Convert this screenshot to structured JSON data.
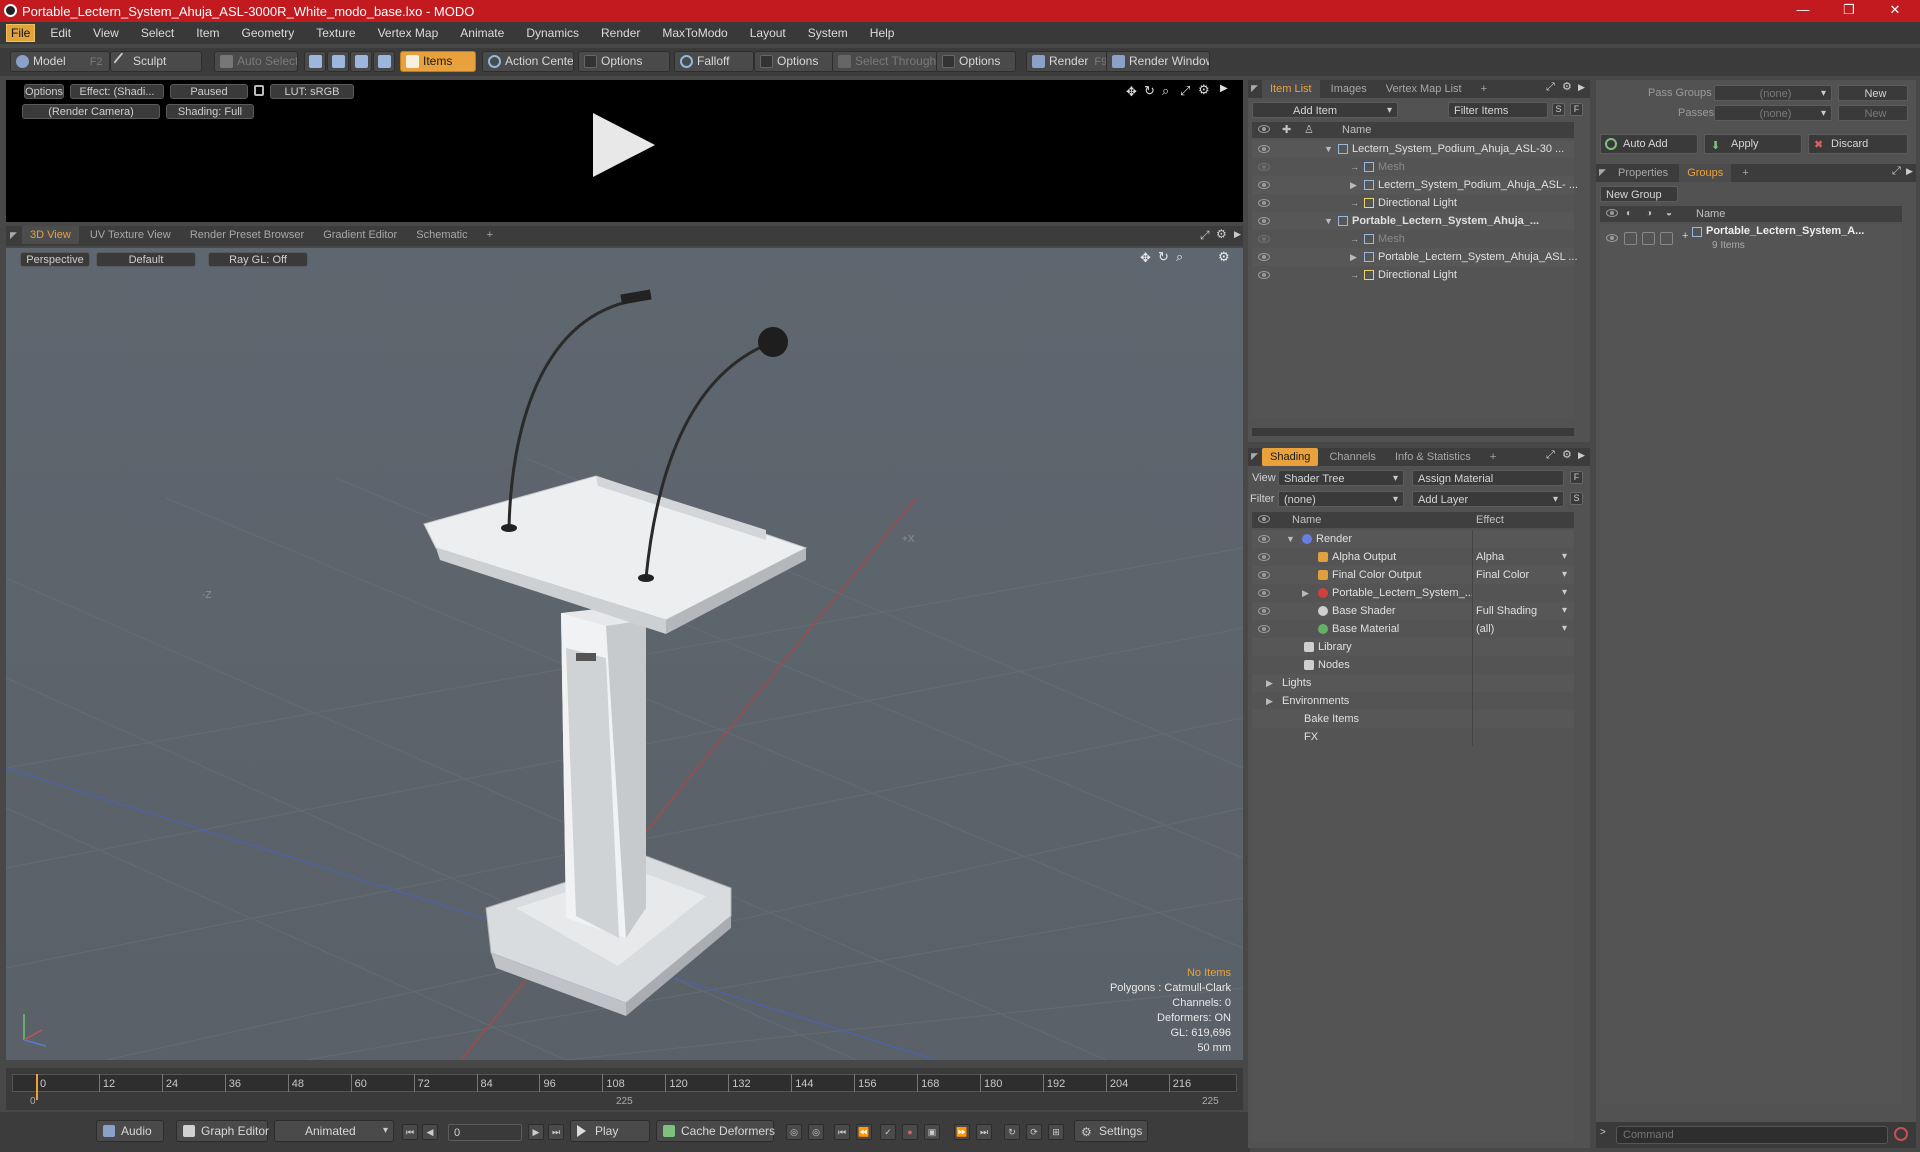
{
  "window": {
    "title": "Portable_Lectern_System_Ahuja_ASL-3000R_White_modo_base.lxo - MODO",
    "min": "—",
    "max": "❐",
    "close": "✕"
  },
  "menu": [
    "File",
    "Edit",
    "View",
    "Select",
    "Item",
    "Geometry",
    "Texture",
    "Vertex Map",
    "Animate",
    "Dynamics",
    "Render",
    "MaxToModo",
    "Layout",
    "System",
    "Help"
  ],
  "toolbar": {
    "model": "Model",
    "model_key": "F2",
    "sculpt": "Sculpt",
    "auto_select": "Auto Select",
    "items": "Items",
    "action_center": "Action Center",
    "options1": "Options",
    "falloff": "Falloff",
    "options2": "Options",
    "select_through": "Select Through",
    "options3": "Options",
    "render": "Render",
    "render_key": "F9",
    "render_window": "Render Window"
  },
  "preview": {
    "options": "Options",
    "effect": "Effect: (Shadi...",
    "paused": "Paused",
    "lut": "LUT: sRGB",
    "camera": "(Render Camera)",
    "shading": "Shading: Full"
  },
  "view_tabs": [
    "3D View",
    "UV Texture View",
    "Render Preset Browser",
    "Gradient Editor",
    "Schematic"
  ],
  "viewport": {
    "projection": "Perspective",
    "style": "Default",
    "raygl": "Ray GL: Off",
    "info": [
      "No Items",
      "Polygons : Catmull-Clark",
      "Channels: 0",
      "Deformers: ON",
      "GL: 619,696",
      "50 mm"
    ],
    "axis_x": "+X",
    "axis_z": "-Z"
  },
  "timeline": {
    "ticks": [
      "0",
      "12",
      "24",
      "36",
      "48",
      "60",
      "72",
      "84",
      "96",
      "108",
      "120",
      "132",
      "144",
      "156",
      "168",
      "180",
      "192",
      "204",
      "216"
    ],
    "start": "0",
    "mid": "225",
    "end": "225"
  },
  "bottom": {
    "audio": "Audio",
    "graph_editor": "Graph Editor",
    "animated": "Animated",
    "frame": "0",
    "play": "Play",
    "cache": "Cache Deformers",
    "settings": "Settings"
  },
  "item_list": {
    "tabs": [
      "Item List",
      "Images",
      "Vertex Map List"
    ],
    "add_item": "Add Item",
    "filter": "Filter Items",
    "s": "S",
    "f": "F",
    "col_name": "Name",
    "rows": [
      {
        "label": "Lectern_System_Podium_Ahuja_ASL-30 ...",
        "indent": 0,
        "bold": false,
        "dim": false
      },
      {
        "label": "Mesh",
        "indent": 1,
        "bold": false,
        "dim": true
      },
      {
        "label": "Lectern_System_Podium_Ahuja_ASL- ...",
        "indent": 1,
        "bold": false,
        "dim": false
      },
      {
        "label": "Directional Light",
        "indent": 1,
        "bold": false,
        "dim": false
      },
      {
        "label": "Portable_Lectern_System_Ahuja_...",
        "indent": 0,
        "bold": true,
        "dim": false
      },
      {
        "label": "Mesh",
        "indent": 1,
        "bold": false,
        "dim": true
      },
      {
        "label": "Portable_Lectern_System_Ahuja_ASL ...",
        "indent": 1,
        "bold": false,
        "dim": false
      },
      {
        "label": "Directional Light",
        "indent": 1,
        "bold": false,
        "dim": false
      }
    ]
  },
  "shading": {
    "tabs": [
      "Shading",
      "Channels",
      "Info & Statistics"
    ],
    "view_label": "View",
    "view_value": "Shader Tree",
    "assign": "Assign Material",
    "filter_label": "Filter",
    "filter_value": "(none)",
    "add_layer": "Add Layer",
    "col_name": "Name",
    "col_effect": "Effect",
    "rows": [
      {
        "name": "Render",
        "effect": ""
      },
      {
        "name": "Alpha Output",
        "effect": "Alpha"
      },
      {
        "name": "Final Color Output",
        "effect": "Final Color"
      },
      {
        "name": "Portable_Lectern_System_...",
        "effect": ""
      },
      {
        "name": "Base Shader",
        "effect": "Full Shading"
      },
      {
        "name": "Base Material",
        "effect": "(all)"
      },
      {
        "name": "Library",
        "effect": ""
      },
      {
        "name": "Nodes",
        "effect": ""
      },
      {
        "name": "Lights",
        "effect": ""
      },
      {
        "name": "Environments",
        "effect": ""
      },
      {
        "name": "Bake Items",
        "effect": ""
      },
      {
        "name": "FX",
        "effect": ""
      }
    ]
  },
  "groups": {
    "pass_groups": "Pass Groups",
    "passes": "Passes",
    "none": "(none)",
    "new": "New",
    "auto_add": "Auto Add",
    "apply": "Apply",
    "discard": "Discard",
    "tabs": [
      "Properties",
      "Groups"
    ],
    "new_group": "New Group",
    "col_name": "Name",
    "group_name": "Portable_Lectern_System_A...",
    "group_count": "9 Items"
  },
  "command": {
    "placeholder": "Command"
  },
  "colors": {
    "accent": "#e9a23b",
    "title": "#c21a1f"
  }
}
